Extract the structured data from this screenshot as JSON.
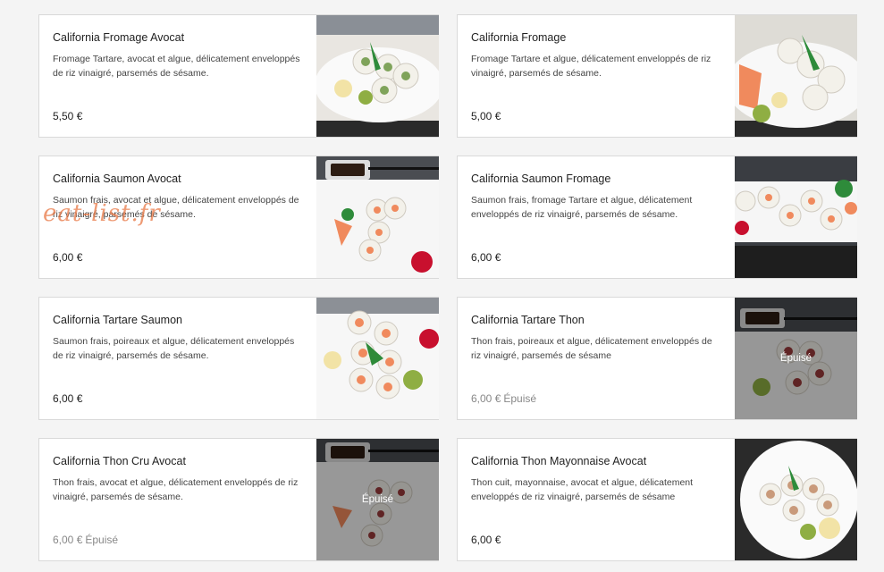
{
  "products": [
    {
      "name": "California Fromage Avocat",
      "description": "Fromage Tartare, avocat et algue, délicatement enveloppés de riz vinaigré, parsemés de sésame.",
      "price": "5,50 €",
      "sold_out": ""
    },
    {
      "name": "California Fromage",
      "description": "Fromage Tartare et algue, délicatement enveloppés de riz vinaigré, parsemés de sésame.",
      "price": "5,00 €",
      "sold_out": ""
    },
    {
      "name": "California Saumon Avocat",
      "description": "Saumon frais, avocat et algue, délicatement enveloppés de riz vinaigré, parsemés de sésame.",
      "price": "6,00 €",
      "sold_out": ""
    },
    {
      "name": "California Saumon Fromage",
      "description": "Saumon frais, fromage Tartare et algue, délicatement enveloppés de riz vinaigré, parsemés de sésame.",
      "price": "6,00 €",
      "sold_out": ""
    },
    {
      "name": "California Tartare Saumon",
      "description": "Saumon frais, poireaux et algue, délicatement enveloppés de riz vinaigré, parsemés de sésame.",
      "price": "6,00 €",
      "sold_out": ""
    },
    {
      "name": "California Tartare Thon",
      "description": "Thon frais, poireaux et algue, délicatement enveloppés de riz vinaigré, parsemés de sésame",
      "price": "6,00 €",
      "sold_out": "Épuisé",
      "overlay": "Épuisé"
    },
    {
      "name": "California Thon Cru Avocat",
      "description": "Thon frais, avocat et algue, délicatement enveloppés de riz vinaigré, parsemés de sésame.",
      "price": "6,00 €",
      "sold_out": "Épuisé",
      "overlay": "Épuisé"
    },
    {
      "name": "California Thon Mayonnaise Avocat",
      "description": "Thon cuit, mayonnaise, avocat et algue, délicatement enveloppés de riz vinaigré, parsemés de sésame",
      "price": "6,00 €",
      "sold_out": ""
    }
  ],
  "watermark": "eat-list.fr",
  "colors": {
    "salmon": "#f08a5d",
    "tuna": "#9a3b3b",
    "leaf": "#2e8b3a",
    "rice": "#f3f1ea"
  }
}
